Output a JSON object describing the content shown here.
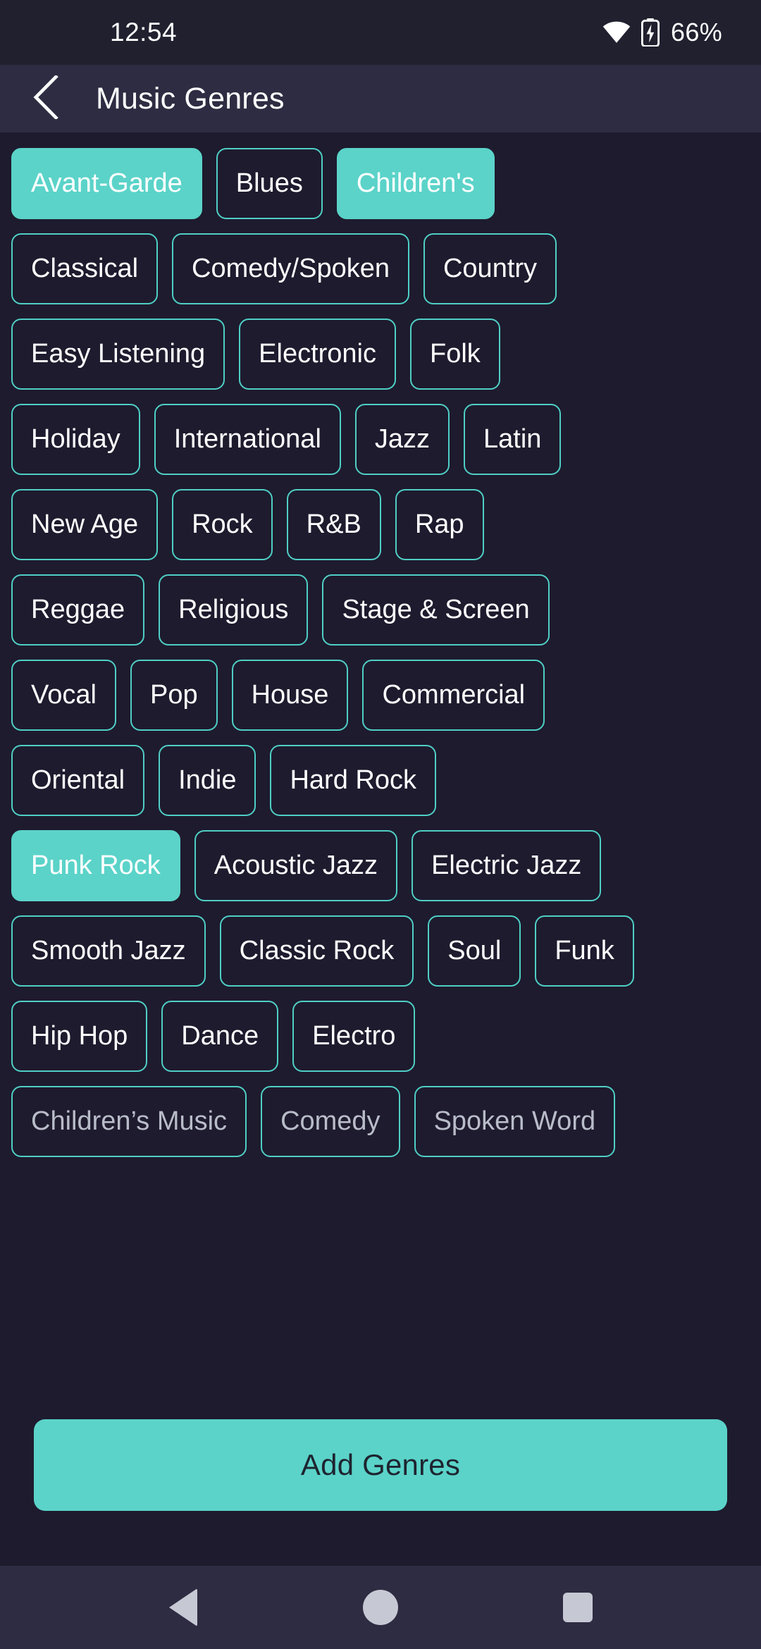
{
  "status_bar": {
    "time": "12:54",
    "battery_percent": "66%",
    "wifi_icon": "wifi-icon",
    "battery_icon": "battery-charging-icon"
  },
  "app_bar": {
    "back_icon": "chevron-left-icon",
    "title": "Music Genres"
  },
  "theme": {
    "accent": "#5bd3c9",
    "background": "#1e1b2e",
    "surface": "#2e2c42",
    "status_bar_bg": "#20202f",
    "chip_border": "#4fcfc5",
    "text_primary": "#ffffff",
    "nav_icon": "#c6c8d4",
    "button_text": "#1e2430"
  },
  "genre_rows": [
    [
      {
        "label": "Avant-Garde",
        "selected": true
      },
      {
        "label": "Blues",
        "selected": false
      },
      {
        "label": "Children's",
        "selected": true
      }
    ],
    [
      {
        "label": "Classical",
        "selected": false
      },
      {
        "label": "Comedy/Spoken",
        "selected": false
      },
      {
        "label": "Country",
        "selected": false
      }
    ],
    [
      {
        "label": "Easy Listening",
        "selected": false
      },
      {
        "label": "Electronic",
        "selected": false
      },
      {
        "label": "Folk",
        "selected": false
      }
    ],
    [
      {
        "label": "Holiday",
        "selected": false
      },
      {
        "label": "International",
        "selected": false
      },
      {
        "label": "Jazz",
        "selected": false
      },
      {
        "label": "Latin",
        "selected": false
      }
    ],
    [
      {
        "label": "New Age",
        "selected": false
      },
      {
        "label": "Rock",
        "selected": false
      },
      {
        "label": "R&B",
        "selected": false
      },
      {
        "label": "Rap",
        "selected": false
      }
    ],
    [
      {
        "label": "Reggae",
        "selected": false
      },
      {
        "label": "Religious",
        "selected": false
      },
      {
        "label": "Stage & Screen",
        "selected": false
      }
    ],
    [
      {
        "label": "Vocal",
        "selected": false
      },
      {
        "label": "Pop",
        "selected": false
      },
      {
        "label": "House",
        "selected": false
      },
      {
        "label": "Commercial",
        "selected": false
      }
    ],
    [
      {
        "label": "Oriental",
        "selected": false
      },
      {
        "label": "Indie",
        "selected": false
      },
      {
        "label": "Hard Rock",
        "selected": false
      }
    ],
    [
      {
        "label": "Punk Rock",
        "selected": true
      },
      {
        "label": "Acoustic Jazz",
        "selected": false
      },
      {
        "label": "Electric Jazz",
        "selected": false
      }
    ],
    [
      {
        "label": "Smooth Jazz",
        "selected": false
      },
      {
        "label": "Classic Rock",
        "selected": false
      },
      {
        "label": "Soul",
        "selected": false
      },
      {
        "label": "Funk",
        "selected": false
      }
    ],
    [
      {
        "label": "Hip Hop",
        "selected": false
      },
      {
        "label": "Dance",
        "selected": false
      },
      {
        "label": "Electro",
        "selected": false
      }
    ],
    [
      {
        "label": "Children’s Music",
        "selected": false
      },
      {
        "label": "Comedy",
        "selected": false
      },
      {
        "label": "Spoken Word",
        "selected": false
      }
    ]
  ],
  "action": {
    "add_genres_label": "Add Genres"
  },
  "nav_bar": {
    "back_icon": "triangle-back-icon",
    "home_icon": "circle-home-icon",
    "recents_icon": "square-recents-icon"
  }
}
